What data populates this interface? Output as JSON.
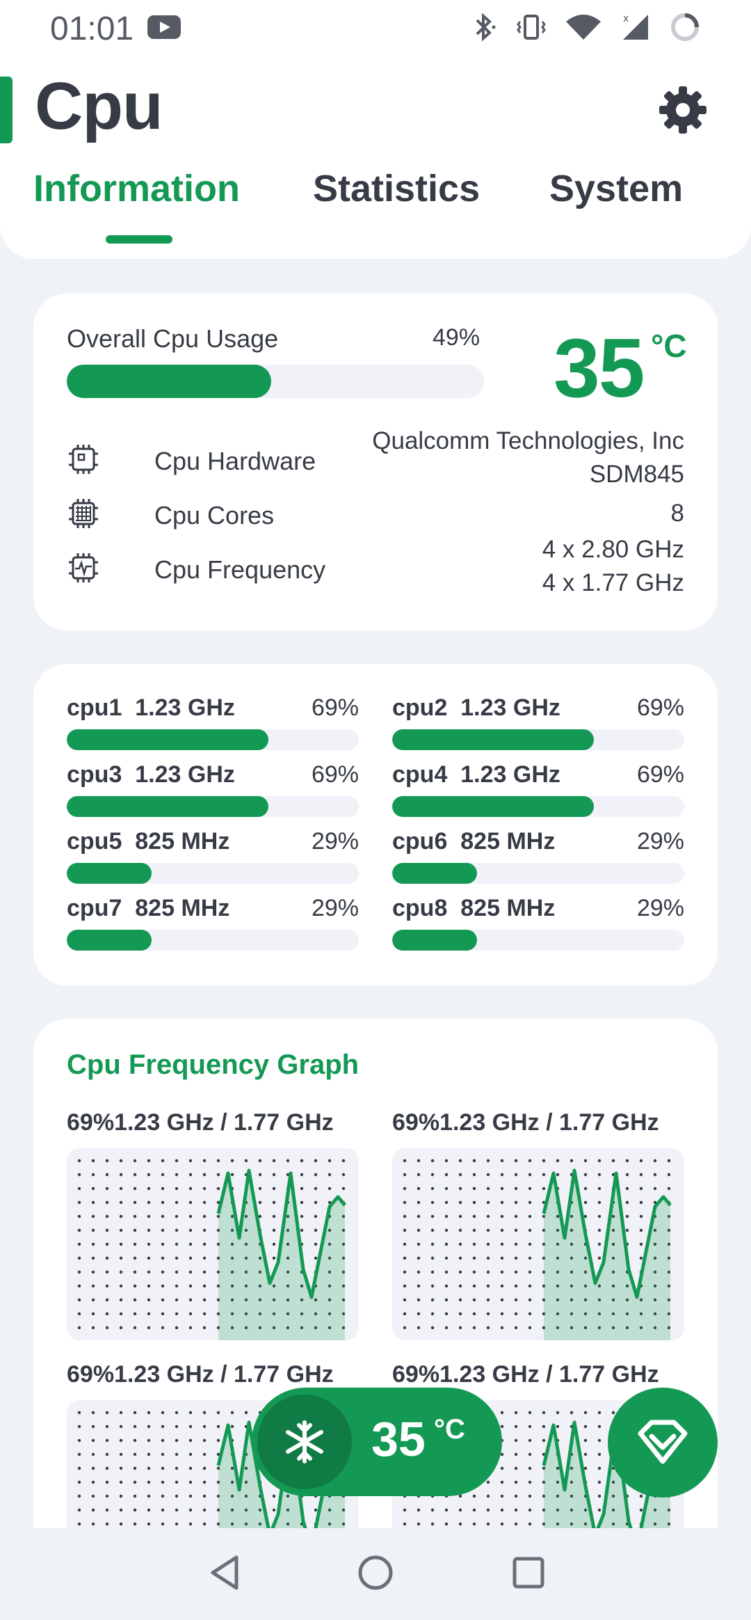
{
  "status_bar": {
    "time": "01:01",
    "icons": [
      "youtube-icon",
      "bluetooth-icon",
      "vibrate-icon",
      "wifi-icon",
      "signal-icon",
      "battery-ring-icon"
    ]
  },
  "header": {
    "title": "Cpu",
    "tabs": [
      {
        "label": "Information",
        "active": true
      },
      {
        "label": "Statistics",
        "active": false
      },
      {
        "label": "System",
        "active": false
      }
    ]
  },
  "overview": {
    "usage_label": "Overall Cpu Usage",
    "usage_percent_text": "49%",
    "usage_fraction": 0.49,
    "temperature": "35",
    "temperature_unit": "°C",
    "rows": [
      {
        "label": "Cpu Hardware",
        "icon": "chip-icon",
        "value_lines": [
          "Qualcomm Technologies, Inc",
          "SDM845"
        ]
      },
      {
        "label": "Cpu Cores",
        "icon": "cores-icon",
        "value_lines": [
          "8"
        ]
      },
      {
        "label": "Cpu Frequency",
        "icon": "frequency-icon",
        "value_lines": [
          "4 x 2.80 GHz",
          "4 x 1.77 GHz"
        ]
      }
    ]
  },
  "cores": [
    {
      "name": "cpu1",
      "freq": "1.23 GHz",
      "pct": "69%",
      "fraction": 0.69
    },
    {
      "name": "cpu2",
      "freq": "1.23 GHz",
      "pct": "69%",
      "fraction": 0.69
    },
    {
      "name": "cpu3",
      "freq": "1.23 GHz",
      "pct": "69%",
      "fraction": 0.69
    },
    {
      "name": "cpu4",
      "freq": "1.23 GHz",
      "pct": "69%",
      "fraction": 0.69
    },
    {
      "name": "cpu5",
      "freq": "825 MHz",
      "pct": "29%",
      "fraction": 0.29
    },
    {
      "name": "cpu6",
      "freq": "825 MHz",
      "pct": "29%",
      "fraction": 0.29
    },
    {
      "name": "cpu7",
      "freq": "825 MHz",
      "pct": "29%",
      "fraction": 0.29
    },
    {
      "name": "cpu8",
      "freq": "825 MHz",
      "pct": "29%",
      "fraction": 0.29
    }
  ],
  "graph": {
    "title": "Cpu Frequency Graph",
    "items": [
      {
        "pct": "69%",
        "freq": "1.23 GHz / 1.77 GHz"
      },
      {
        "pct": "69%",
        "freq": "1.23 GHz / 1.77 GHz"
      },
      {
        "pct": "69%",
        "freq": "1.23 GHz / 1.77 GHz"
      },
      {
        "pct": "69%",
        "freq": "1.23 GHz / 1.77 GHz"
      }
    ]
  },
  "floating": {
    "temperature": "35",
    "temperature_unit": "°C",
    "temp_icon": "snowflake-icon",
    "pro_icon": "diamond-icon"
  },
  "colors": {
    "accent": "#149954",
    "accent_dark": "#117b45",
    "background": "#eff2f7",
    "card": "#ffffff",
    "text": "#363b45"
  }
}
